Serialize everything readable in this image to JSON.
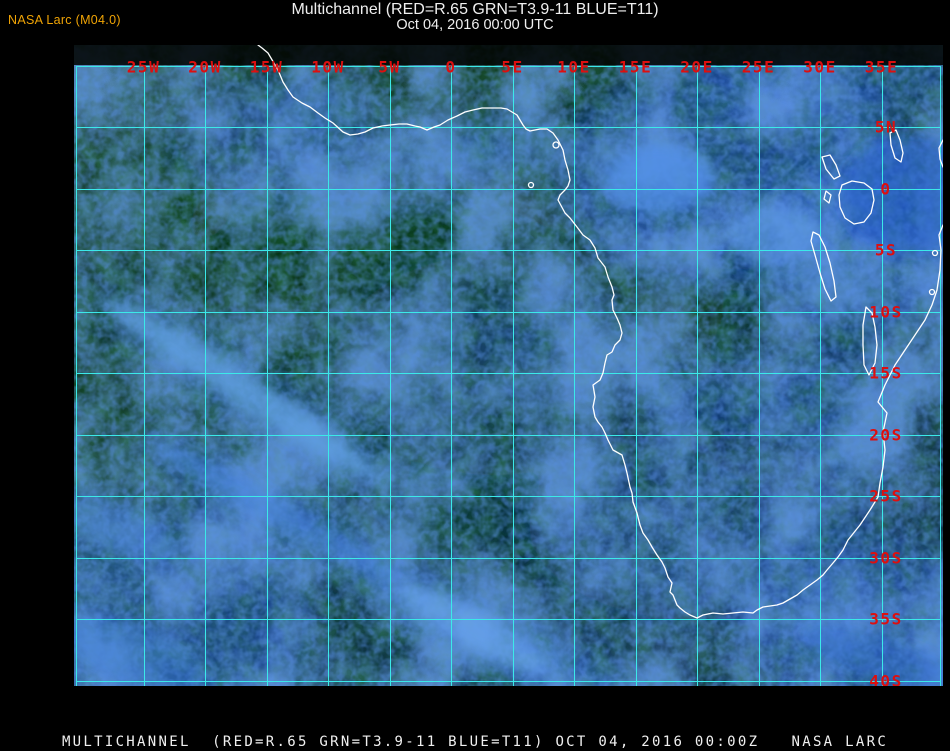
{
  "header": {
    "title": "Multichannel (RED=R.65 GRN=T3.9-11 BLUE=T11)",
    "subtitle": "Oct 04, 2016 00:00 UTC",
    "credit": "NASA Larc (M04.0)"
  },
  "footer": {
    "caption": "MULTICHANNEL  (RED=R.65 GRN=T3.9-11 BLUE=T11) OCT 04, 2016 00:00Z   NASA LARC"
  },
  "map": {
    "region": "Africa",
    "longitude_labels": [
      "25W",
      "20W",
      "15W",
      "10W",
      "5W",
      "0",
      "5E",
      "10E",
      "15E",
      "20E",
      "25E",
      "30E",
      "35E"
    ],
    "latitude_labels": [
      "5N",
      "0",
      "5S",
      "10S",
      "15S",
      "20S",
      "25S",
      "30S",
      "35S",
      "40S"
    ],
    "colors": {
      "grid": "#3be9e9",
      "label": "#dd0f0f",
      "coastline": "#ffffff",
      "credit": "#f0a405",
      "title": "#efefef",
      "caption": "#f0f0f0",
      "background": "#000000"
    }
  }
}
